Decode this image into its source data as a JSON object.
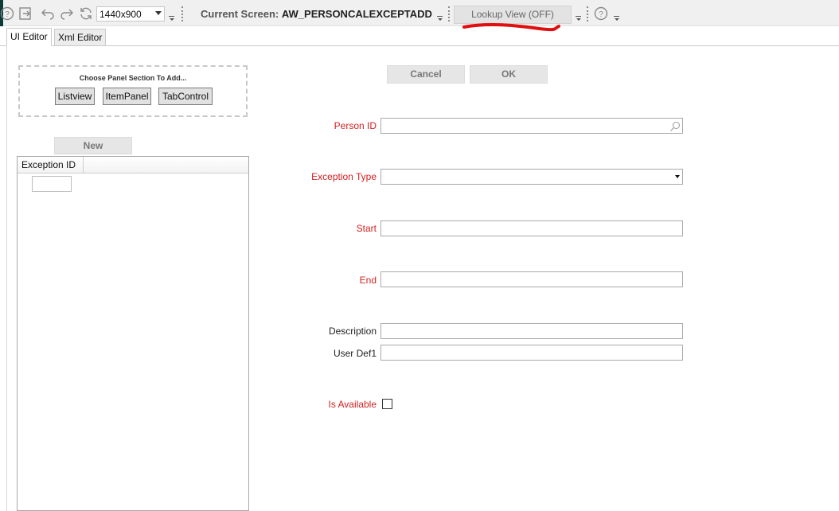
{
  "toolbar": {
    "resolution": "1440x900",
    "current_screen_label": "Current Screen:",
    "current_screen_value": "AW_PERSONCALEXCEPTADD",
    "lookup_view_label": "Lookup View (OFF)",
    "icons": [
      "help-icon",
      "exit-icon",
      "undo-icon",
      "redo-icon",
      "refresh-icon",
      "help-icon"
    ],
    "underline_color": "#e01010"
  },
  "tabs": [
    {
      "label": "UI Editor",
      "active": true
    },
    {
      "label": "Xml Editor",
      "active": false
    }
  ],
  "panel": {
    "title": "Choose Panel Section To Add...",
    "buttons": [
      "Listview",
      "ItemPanel",
      "TabControl"
    ],
    "new_label": "New"
  },
  "grid": {
    "columns": [
      "Exception ID"
    ]
  },
  "form": {
    "cancel_label": "Cancel",
    "ok_label": "OK",
    "fields": [
      {
        "label": "Person ID",
        "required": true,
        "type": "lookup",
        "value": ""
      },
      {
        "label": "Exception Type",
        "required": true,
        "type": "dropdown",
        "value": ""
      },
      {
        "label": "Start",
        "required": true,
        "type": "text",
        "value": ""
      },
      {
        "label": "End",
        "required": true,
        "type": "text",
        "value": ""
      },
      {
        "label": "Description",
        "required": false,
        "type": "text",
        "value": ""
      },
      {
        "label": "User Def1",
        "required": false,
        "type": "text",
        "value": ""
      },
      {
        "label": "Is Available",
        "required": true,
        "type": "checkbox",
        "checked": false
      }
    ]
  },
  "colors": {
    "required_label": "#d42020",
    "toolbar_bg": "#f0f0f0"
  }
}
